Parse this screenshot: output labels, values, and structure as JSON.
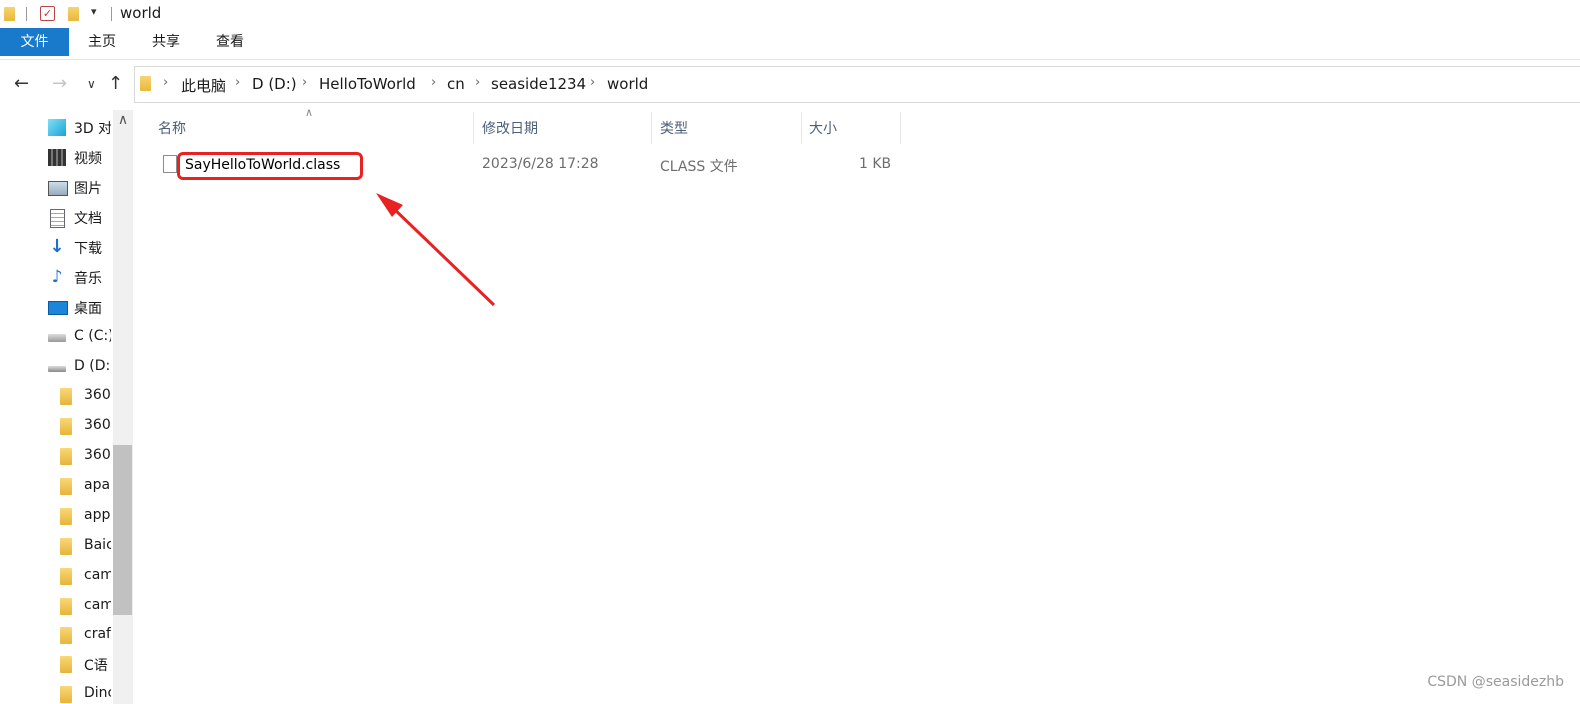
{
  "window": {
    "title": "world"
  },
  "ribbon": {
    "tabs": [
      "文件",
      "主页",
      "共享",
      "查看"
    ]
  },
  "breadcrumb": [
    "此电脑",
    "D (D:)",
    "HelloToWorld",
    "cn",
    "seaside1234",
    "world"
  ],
  "sidebar": {
    "items": [
      {
        "label": "3D 对",
        "icon": "3d-objects-icon"
      },
      {
        "label": "视频",
        "icon": "video-icon"
      },
      {
        "label": "图片",
        "icon": "pictures-icon"
      },
      {
        "label": "文档",
        "icon": "documents-icon"
      },
      {
        "label": "下载",
        "icon": "downloads-icon"
      },
      {
        "label": "音乐",
        "icon": "music-icon"
      },
      {
        "label": "桌面",
        "icon": "desktop-icon"
      },
      {
        "label": "C (C:)",
        "icon": "drive-c-icon"
      },
      {
        "label": "D (D:)",
        "icon": "drive-d-icon"
      }
    ],
    "subfolders": [
      "360",
      "360",
      "360",
      "apa",
      "app",
      "Baic",
      "cam",
      "cam",
      "craf",
      "C语",
      "Dinc"
    ]
  },
  "columns": {
    "name": "名称",
    "modified": "修改日期",
    "type": "类型",
    "size": "大小"
  },
  "files": [
    {
      "name": "SayHelloToWorld.class",
      "modified": "2023/6/28 17:28",
      "type": "CLASS 文件",
      "size": "1 KB"
    }
  ],
  "watermark": "CSDN @seasidezhb",
  "colors": {
    "highlight": "#e82222",
    "file_tab": "#1979ca"
  }
}
